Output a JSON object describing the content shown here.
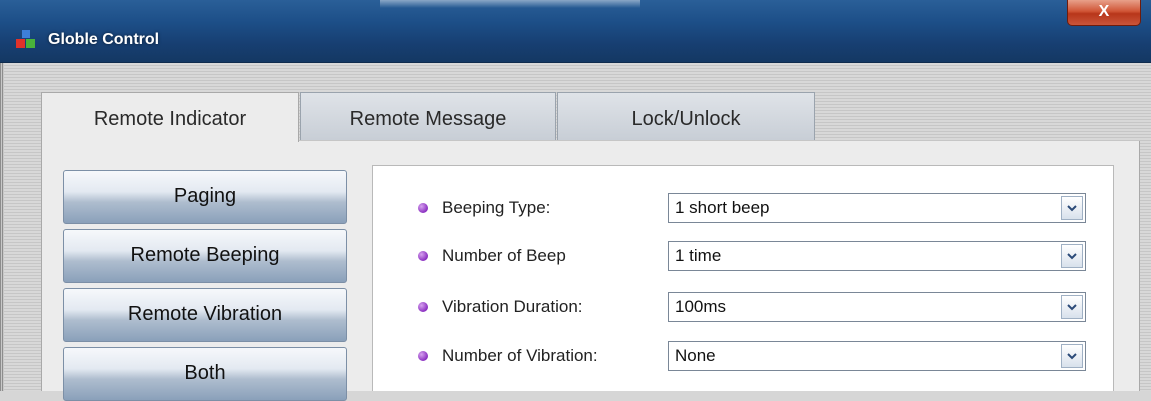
{
  "window": {
    "title": "Globle Control",
    "close_label": "X"
  },
  "tabs": [
    {
      "label": "Remote Indicator",
      "active": true
    },
    {
      "label": "Remote Message",
      "active": false
    },
    {
      "label": "Lock/Unlock",
      "active": false
    }
  ],
  "sidebar": {
    "buttons": [
      {
        "label": "Paging"
      },
      {
        "label": "Remote Beeping"
      },
      {
        "label": "Remote Vibration"
      },
      {
        "label": "Both"
      }
    ]
  },
  "settings": [
    {
      "label": "Beeping Type:",
      "value": "1 short beep"
    },
    {
      "label": "Number of Beep",
      "value": "1 time"
    },
    {
      "label": "Vibration Duration:",
      "value": "100ms"
    },
    {
      "label": "Number of Vibration:",
      "value": "None"
    }
  ],
  "colors": {
    "titlebar": "#1d4f88",
    "bullet": "#8a2fc0",
    "close": "#c9553a"
  }
}
